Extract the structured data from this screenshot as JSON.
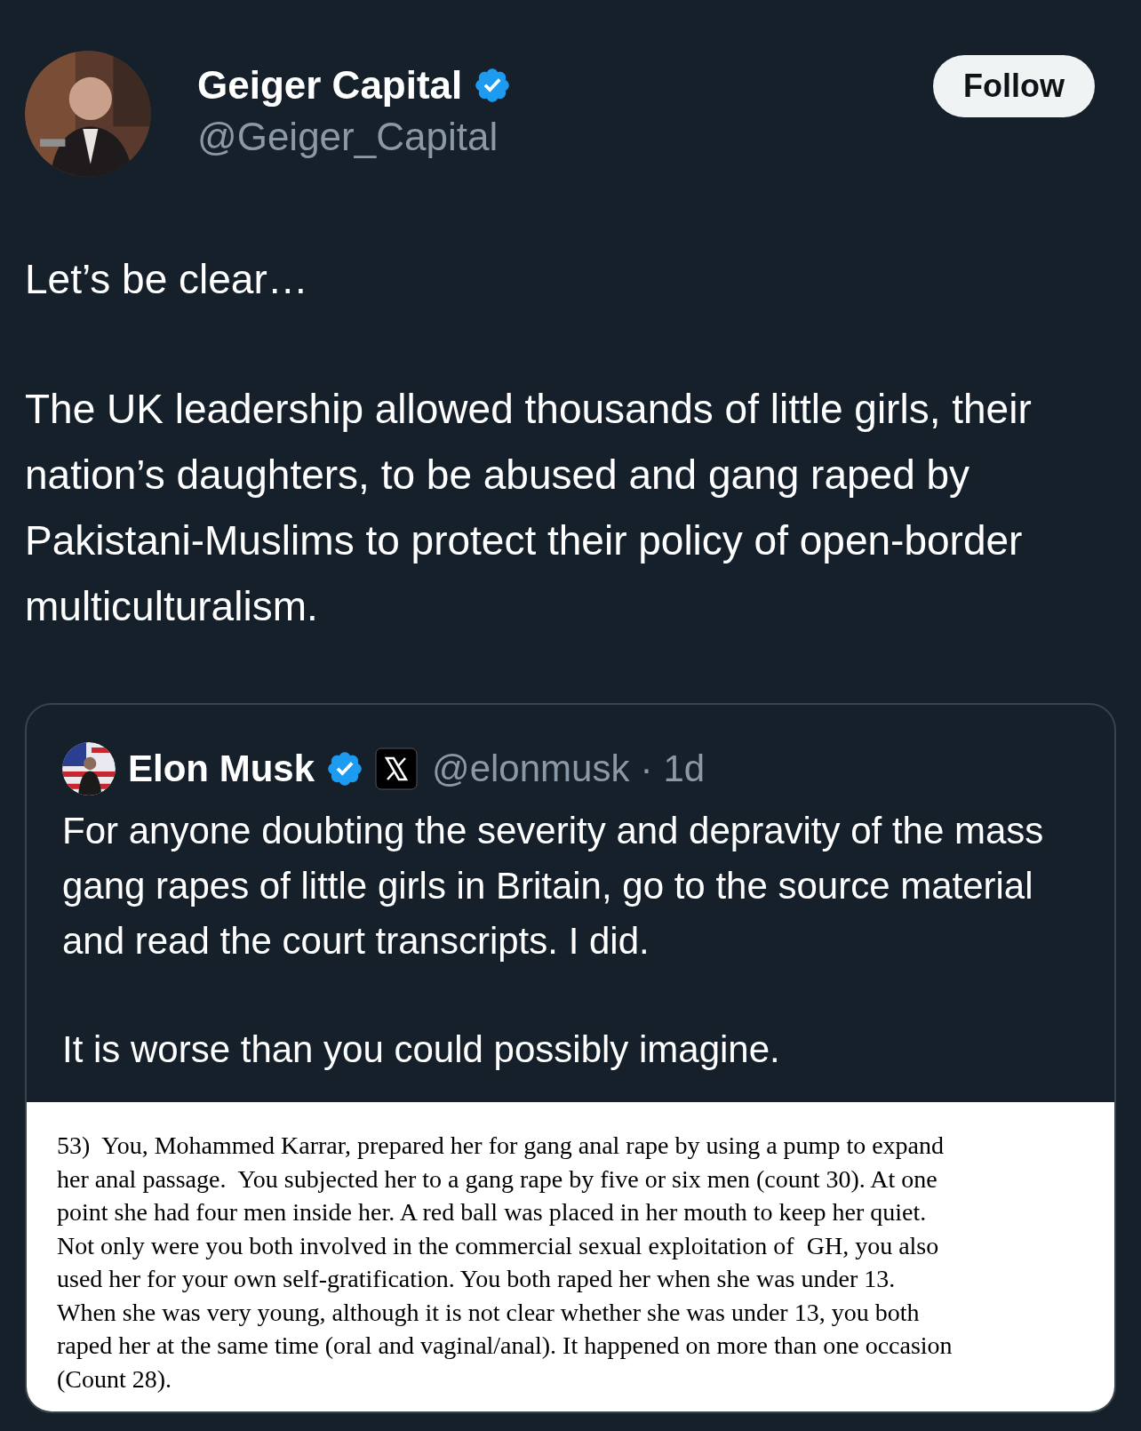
{
  "author": {
    "name": "Geiger Capital",
    "handle": "@Geiger_Capital",
    "verified": true
  },
  "follow_button": "Follow",
  "tweet_text": [
    "Let’s be clear…",
    "The UK leadership allowed thousands of little girls, their nation’s daughters, to be abused and gang raped by Pakistani-Muslims to protect their policy of open-border multiculturalism."
  ],
  "quoted_tweet": {
    "author": {
      "name": "Elon Musk",
      "verified": true,
      "handle": "@elonmusk",
      "separator": "·",
      "time": "1d"
    },
    "text": [
      "For anyone doubting the severity and depravity of the mass gang rapes of little girls in Britain, go to the source material and read the court transcripts. I did.",
      "It is worse than you could possibly imagine."
    ],
    "document": {
      "lines": [
        "53)  You, Mohammed Karrar, prepared her for gang anal rape by using a pump to expand",
        "her anal passage.  You subjected her to a gang rape by five or six men (count 30). At one",
        "point she had four men inside her. A red ball was placed in her mouth to keep her quiet.",
        "Not only were you both involved in the commercial sexual exploitation of  GH, you also",
        "used her for your own self-gratification. You both raped her when she was under 13.",
        "When she was very young, although it is not clear whether she was under 13, you both",
        "raped her at the same time (oral and vaginal/anal). It happened on more than one occasion",
        "(Count 28)."
      ]
    }
  }
}
